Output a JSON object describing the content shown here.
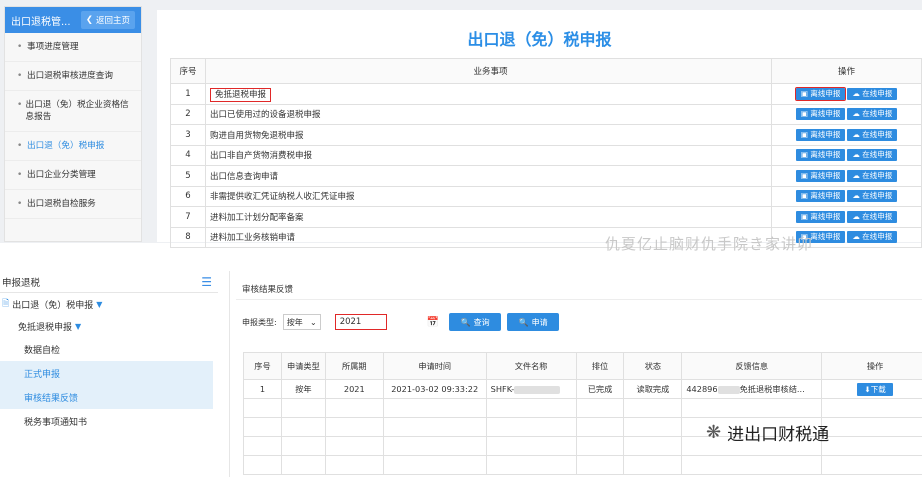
{
  "top": {
    "sidebar": {
      "system_title": "出口退税管...",
      "back_label": "返回主页",
      "items": [
        "事项进度管理",
        "出口退税审核进度查询",
        "出口退（免）税企业资格信息报告",
        "出口退（免）税申报",
        "出口企业分类管理",
        "出口退税自检服务"
      ]
    },
    "page_title": "出口退（免）税申报",
    "table": {
      "headers": [
        "序号",
        "业务事项",
        "操作"
      ],
      "offline_label": "离线申报",
      "online_label": "在线申报",
      "rows": [
        {
          "no": "1",
          "item": "免抵退税申报"
        },
        {
          "no": "2",
          "item": "出口已使用过的设备退税申报"
        },
        {
          "no": "3",
          "item": "购进自用货物免退税申报"
        },
        {
          "no": "4",
          "item": "出口非自产货物消费税申报"
        },
        {
          "no": "5",
          "item": "出口信息查询申请"
        },
        {
          "no": "6",
          "item": "非需提供收汇凭证纳税人收汇凭证申报"
        },
        {
          "no": "7",
          "item": "进料加工计划分配率备案"
        },
        {
          "no": "8",
          "item": "进料加工业务核销申请"
        }
      ]
    },
    "watermark": "仇夏亿止脑财仇手院き家讲卯"
  },
  "bottom": {
    "sidebar": {
      "title": "申报退税",
      "level1": "出口退（免）税申报",
      "level2": "免抵退税申报",
      "items": [
        "数据自检",
        "正式申报",
        "审核结果反馈",
        "税务事项通知书"
      ]
    },
    "crumb": "审核结果反馈",
    "filters": {
      "type_label": "申报类型:",
      "type_value": "按年",
      "year_value": "2021",
      "query_label": "查询",
      "apply_label": "申请"
    },
    "table": {
      "headers": [
        "序号",
        "申请类型",
        "所属期",
        "申请时间",
        "文件名称",
        "排位",
        "状态",
        "反馈信息",
        "操作"
      ],
      "rows": [
        {
          "no": "1",
          "type": "按年",
          "period": "2021",
          "time": "2021-03-02 09:33:22",
          "file": "SHFK-",
          "rank": "已完成",
          "status": "读取完成",
          "feedback_prefix": "442896",
          "feedback_suffix": "免抵退税审核结...",
          "action": "下载"
        }
      ]
    },
    "watermark": "进出口财税通"
  }
}
